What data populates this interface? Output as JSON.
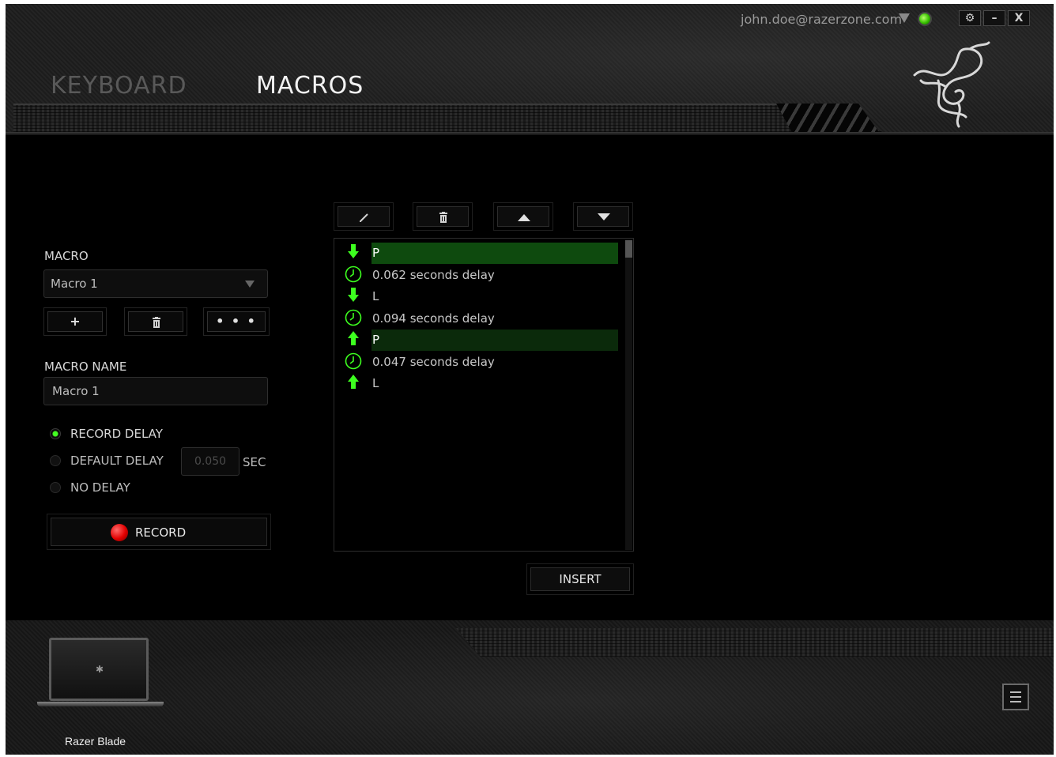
{
  "header": {
    "account_email": "john.doe@razerzone.com",
    "tabs": [
      {
        "label": "KEYBOARD",
        "active": false
      },
      {
        "label": "MACROS",
        "active": true
      }
    ],
    "window_controls": {
      "settings": "⚙",
      "minimize": "–",
      "close": "X"
    },
    "status_color": "#36c000"
  },
  "macro_panel": {
    "macro_label": "MACRO",
    "selected_macro": "Macro 1",
    "buttons": {
      "add": "+",
      "delete": "🗑",
      "more": "• • •"
    },
    "macro_name_label": "MACRO NAME",
    "macro_name_value": "Macro 1",
    "delay_options": [
      {
        "label": "RECORD DELAY",
        "selected": true
      },
      {
        "label": "DEFAULT DELAY",
        "selected": false
      },
      {
        "label": "NO DELAY",
        "selected": false
      }
    ],
    "default_delay_value": "0.050",
    "default_delay_unit": "SEC",
    "record_label": "RECORD",
    "record_color": "#e20000"
  },
  "editor": {
    "toolbar": [
      "edit-icon",
      "trash-icon",
      "arrow-up-icon",
      "arrow-down-icon"
    ],
    "actions": [
      {
        "type": "key_down",
        "text": "P",
        "icon": "arrow-down-icon",
        "highlight": "strong"
      },
      {
        "type": "delay",
        "text": "0.062 seconds delay",
        "icon": "clock-icon",
        "highlight": "none"
      },
      {
        "type": "key_down",
        "text": "L",
        "icon": "arrow-down-icon",
        "highlight": "none"
      },
      {
        "type": "delay",
        "text": "0.094 seconds delay",
        "icon": "clock-icon",
        "highlight": "none"
      },
      {
        "type": "key_up",
        "text": "P",
        "icon": "arrow-up-icon",
        "highlight": "weak"
      },
      {
        "type": "delay",
        "text": "0.047 seconds delay",
        "icon": "clock-icon",
        "highlight": "none"
      },
      {
        "type": "key_up",
        "text": "L",
        "icon": "arrow-up-icon",
        "highlight": "none"
      }
    ],
    "insert_label": "INSERT",
    "accent_color": "#44ff22"
  },
  "footer": {
    "device_name": "Razer Blade"
  }
}
